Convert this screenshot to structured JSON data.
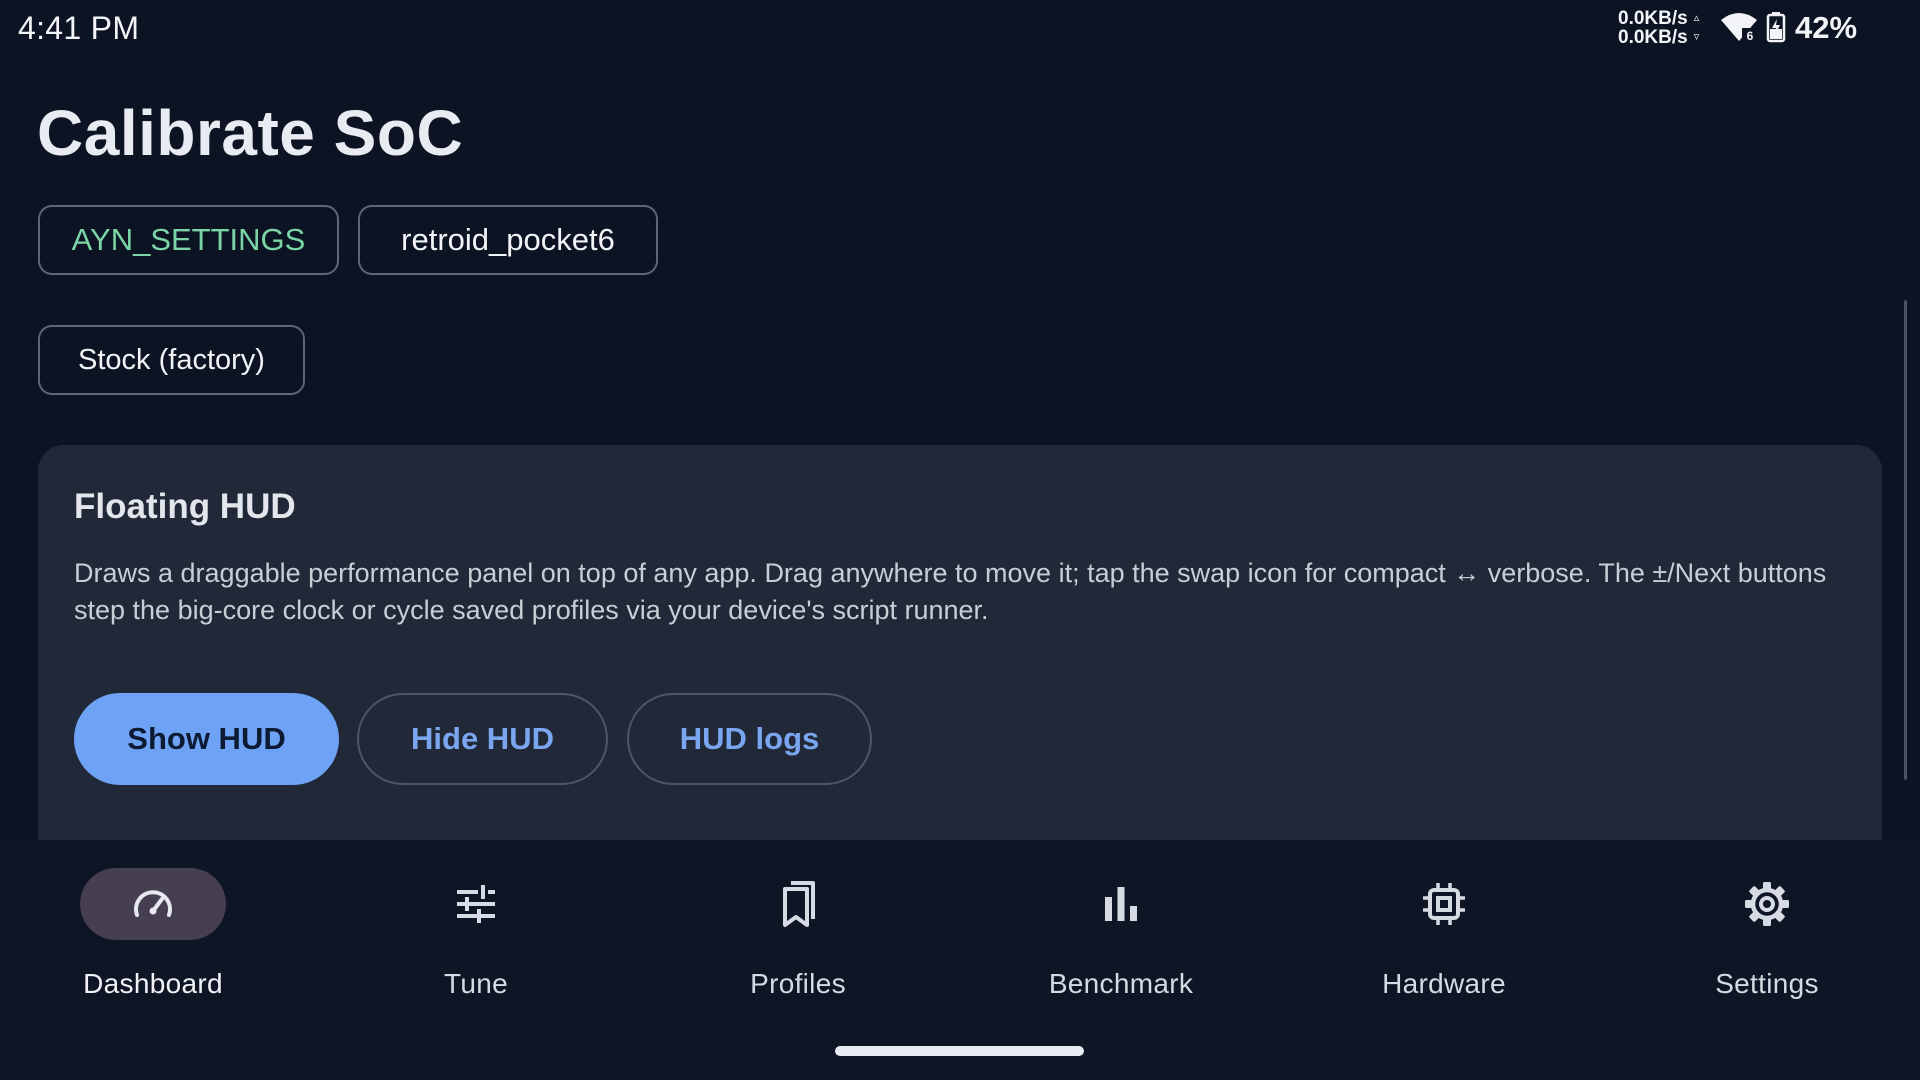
{
  "status_bar": {
    "time": "4:41 PM",
    "upload_speed": "0.0KB/s",
    "download_speed": "0.0KB/s",
    "upload_arrow": "▵",
    "download_arrow": "▿",
    "battery_percent": "42%",
    "wifi_icon": "wifi-6-icon",
    "battery_icon": "battery-charging-icon"
  },
  "page": {
    "title": "Calibrate SoC"
  },
  "chips": {
    "device_vendor": "AYN_SETTINGS",
    "device_model": "retroid_pocket6",
    "profile": "Stock (factory)"
  },
  "hud_card": {
    "title": "Floating HUD",
    "description": "Draws a draggable performance panel on top of any app. Drag anywhere to move it; tap the swap icon for compact ↔ verbose. The ±/Next buttons step the big-core clock or cycle saved profiles via your device's script runner.",
    "show_button": "Show HUD",
    "hide_button": "Hide HUD",
    "logs_button": "HUD logs"
  },
  "bottom_nav": {
    "items": [
      {
        "label": "Dashboard",
        "icon": "speedometer-icon",
        "active": true
      },
      {
        "label": "Tune",
        "icon": "sliders-icon",
        "active": false
      },
      {
        "label": "Profiles",
        "icon": "bookmarks-icon",
        "active": false
      },
      {
        "label": "Benchmark",
        "icon": "bar-chart-icon",
        "active": false
      },
      {
        "label": "Hardware",
        "icon": "chip-icon",
        "active": false
      },
      {
        "label": "Settings",
        "icon": "gear-icon",
        "active": false
      }
    ]
  },
  "colors": {
    "background": "#0c1322",
    "card": "#212938",
    "accent": "#6ea2f5",
    "chip_green_text": "#7ad4a6",
    "nav_active_pill": "#463f52"
  }
}
